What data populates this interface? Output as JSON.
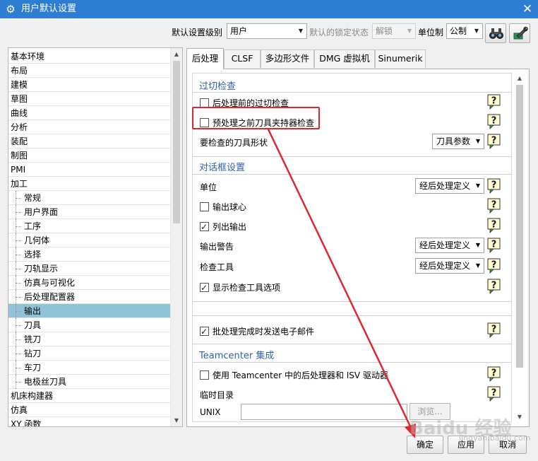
{
  "window": {
    "title": "用户默认设置",
    "close_glyph": "✕",
    "app_icon": "gear-icon"
  },
  "toolbar": {
    "level_label": "默认设置级别",
    "level_value": "用户",
    "lock_label": "默认的锁定状态",
    "lock_value": "解锁",
    "unit_label": "单位制",
    "unit_value": "公制",
    "buttons": [
      "binoculars-icon",
      "wrench-settings-icon"
    ]
  },
  "tree": {
    "items": [
      {
        "label": "基本环境",
        "level": 0
      },
      {
        "label": "布局",
        "level": 0
      },
      {
        "label": "建模",
        "level": 0
      },
      {
        "label": "草图",
        "level": 0
      },
      {
        "label": "曲线",
        "level": 0
      },
      {
        "label": "分析",
        "level": 0
      },
      {
        "label": "装配",
        "level": 0
      },
      {
        "label": "制图",
        "level": 0
      },
      {
        "label": "PMI",
        "level": 0
      },
      {
        "label": "加工",
        "level": 0
      },
      {
        "label": "常规",
        "level": 1
      },
      {
        "label": "用户界面",
        "level": 1
      },
      {
        "label": "工序",
        "level": 1
      },
      {
        "label": "几何体",
        "level": 1
      },
      {
        "label": "选择",
        "level": 1
      },
      {
        "label": "刀轨显示",
        "level": 1
      },
      {
        "label": "仿真与可视化",
        "level": 1
      },
      {
        "label": "后处理配置器",
        "level": 1
      },
      {
        "label": "输出",
        "level": 1,
        "selected": true
      },
      {
        "label": "刀具",
        "level": 1
      },
      {
        "label": "铣刀",
        "level": 1
      },
      {
        "label": "钻刀",
        "level": 1
      },
      {
        "label": "车刀",
        "level": 1
      },
      {
        "label": "电极丝刀具",
        "level": 1
      },
      {
        "label": "机床构建器",
        "level": 0
      },
      {
        "label": "仿真",
        "level": 0
      },
      {
        "label": "XY 函数",
        "level": 0
      }
    ],
    "scroll": {
      "up": "▲",
      "down": "▼"
    }
  },
  "tabs": [
    {
      "label": "后处理",
      "active": true
    },
    {
      "label": "CLSF"
    },
    {
      "label": "多边形文件"
    },
    {
      "label": "DMG 虚拟机"
    },
    {
      "label": "Sinumerik"
    }
  ],
  "panel": {
    "sections": {
      "gouge": "过切检查",
      "dialog": "对话框设置",
      "teamcenter": "Teamcenter 集成"
    },
    "items": {
      "pre_gouge": {
        "label": "后处理前的过切检查",
        "checked": false
      },
      "pre_holder": {
        "label": "预处理之前刀具夹持器检查",
        "checked": false
      },
      "tool_shape": {
        "label": "要检查的刀具形状",
        "value": "刀具参数"
      },
      "unit": {
        "label": "单位",
        "value": "经后处理定义"
      },
      "ball_center": {
        "label": "输出球心",
        "checked": false
      },
      "list_output": {
        "label": "列出输出",
        "checked": true
      },
      "output_warning": {
        "label": "输出警告",
        "value": "经后处理定义"
      },
      "check_tool": {
        "label": "检查工具",
        "value": "经后处理定义"
      },
      "show_check_options": {
        "label": "显示检查工具选项",
        "checked": true
      },
      "email": {
        "label": "批处理完成时发送电子邮件",
        "checked": true
      },
      "use_teamcenter": {
        "label": "使用 Teamcenter 中的后处理器和 ISV 驱动器",
        "checked": false
      },
      "temp_dir": {
        "label": "临时目录"
      },
      "unix": {
        "label": "UNIX",
        "value": "",
        "browse": "浏览..."
      }
    },
    "help_icon": "question-help-icon"
  },
  "buttons": {
    "ok": "确定",
    "apply": "应用",
    "cancel": "取消"
  },
  "watermark": {
    "text": "Baidu 经验",
    "sub": "jingyan.baidu.com"
  },
  "annotation": {
    "color": "#e0262e"
  }
}
